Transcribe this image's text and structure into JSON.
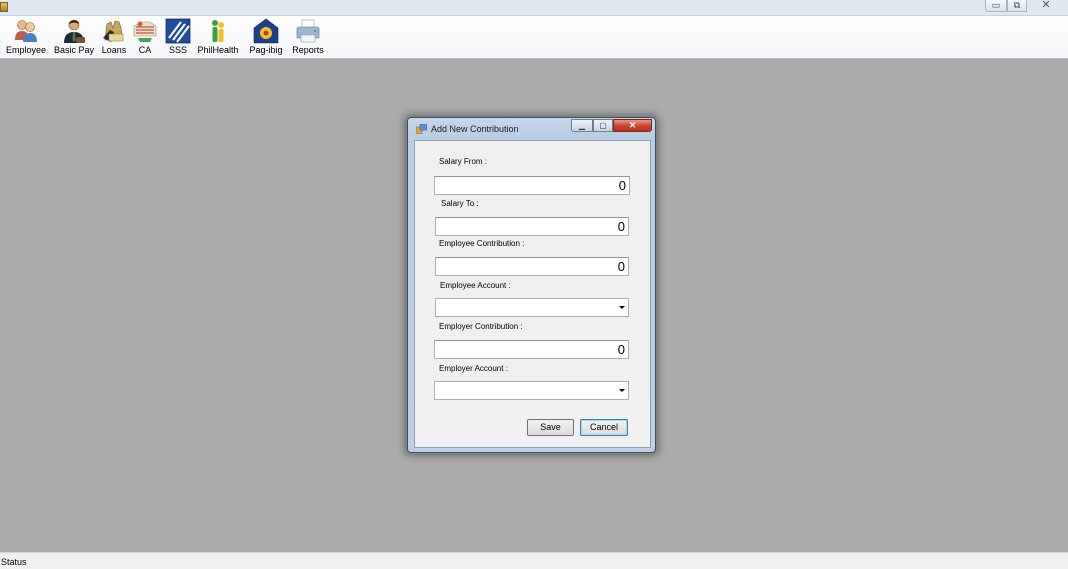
{
  "toolbar": {
    "items": [
      {
        "label": "Employee",
        "icon": "employee-group-icon"
      },
      {
        "label": "Basic Pay",
        "icon": "businessman-icon"
      },
      {
        "label": "Loans",
        "icon": "money-bag-icon"
      },
      {
        "label": "CA",
        "icon": "cash-advance-icon"
      },
      {
        "label": "SSS",
        "icon": "sss-logo-icon"
      },
      {
        "label": "PhilHealth",
        "icon": "philhealth-logo-icon"
      },
      {
        "label": "Pag-ibig",
        "icon": "pagibig-logo-icon"
      },
      {
        "label": "Reports",
        "icon": "printer-icon"
      }
    ]
  },
  "dialog": {
    "title": "Add New Contribution",
    "salary_from": {
      "label": "Salary From :",
      "value": "0"
    },
    "salary_to": {
      "label": "Salary To :",
      "value": "0"
    },
    "employee_contribution": {
      "label": "Employee Contribution :",
      "value": "0"
    },
    "employee_account": {
      "label": "Employee Account :",
      "value": ""
    },
    "employer_contribution": {
      "label": "Employer Contribution :",
      "value": "0"
    },
    "employer_account": {
      "label": "Employer Account :",
      "value": ""
    },
    "save_label": "Save",
    "cancel_label": "Cancel"
  },
  "status": {
    "text": "Status"
  },
  "colors": {
    "mdi_background": "#ababab",
    "dialog_frame": "#bccfe3",
    "close_button": "#c7402b"
  }
}
